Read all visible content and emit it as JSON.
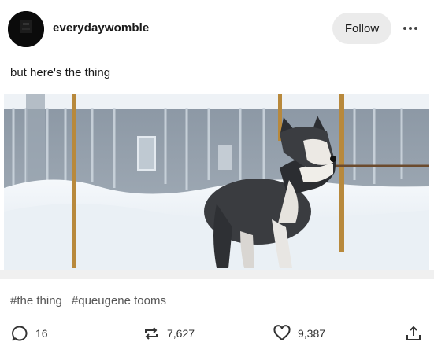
{
  "post": {
    "username": "everydaywomble",
    "follow_label": "Follow",
    "caption": "but here's the thing",
    "tags": [
      "#the thing",
      "#queugene tooms"
    ],
    "counts": {
      "replies": "16",
      "reblogs": "7,627",
      "likes": "9,387"
    }
  },
  "icons": {
    "avatar": "dark-avatar",
    "more": "ellipsis-icon",
    "reply": "speech-bubble-icon",
    "reblog": "reblog-arrows-icon",
    "like": "heart-icon",
    "share": "share-upload-icon"
  },
  "colors": {
    "accent": "#1a1a1a",
    "button_bg": "#ebebeb",
    "divider": "#f0f0f0"
  }
}
